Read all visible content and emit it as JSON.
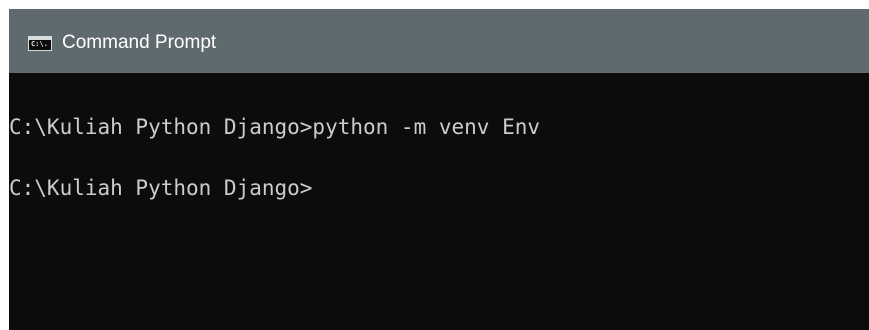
{
  "window": {
    "title": "Command Prompt",
    "icon": "cmd-icon",
    "icon_glyph": "C:\\."
  },
  "console": {
    "lines": [
      "C:\\Kuliah Python Django>python -m venv Env",
      "C:\\Kuliah Python Django>"
    ],
    "text_color": "#cccccc",
    "background_color": "#0c0c0c"
  },
  "colors": {
    "titlebar": "#5f6a6e",
    "title_text": "#ffffff"
  }
}
